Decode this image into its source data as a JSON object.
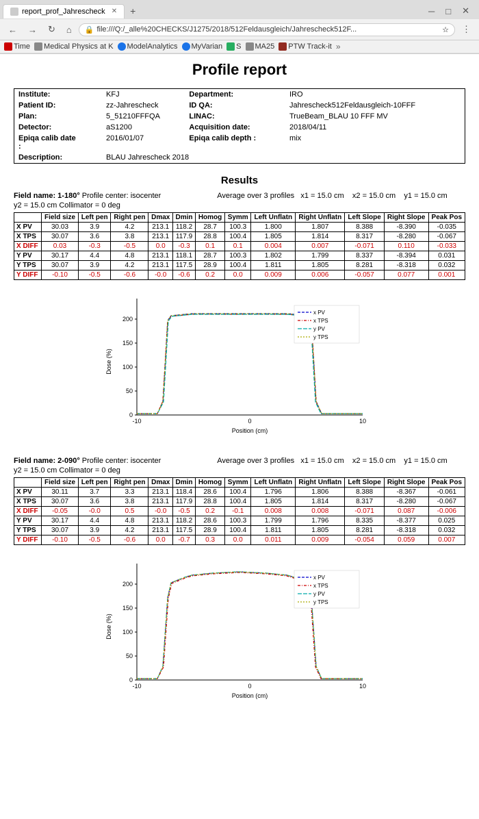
{
  "browser": {
    "tab_title": "report_prof_Jahrescheck",
    "address": "file:///Q:/_alle%20CHECKS/J1275/2018/512Feldausgleich/Jahrescheck512F...",
    "bookmarks": [
      "Time",
      "Medical Physics at K",
      "ModelAnalytics",
      "MyVarian",
      "S",
      "MA25",
      "PTW Track-it"
    ]
  },
  "page": {
    "title": "Profile report"
  },
  "info": {
    "institute_label": "Institute:",
    "institute_value": "KFJ",
    "department_label": "Department:",
    "department_value": "IRO",
    "patient_id_label": "Patient ID:",
    "patient_id_value": "zz-Jahrescheck",
    "id_qa_label": "ID QA:",
    "id_qa_value": "Jahrescheck512Feldausgleich-10FFF",
    "plan_label": "Plan:",
    "plan_value": "5_51210FFFQA",
    "linac_label": "LINAC:",
    "linac_value": "TrueBeam_BLAU  10 FFF MV",
    "detector_label": "Detector:",
    "detector_value": "aS1200",
    "acquisition_date_label": "Acquisition date:",
    "acquisition_date_value": "2018/04/11",
    "epiqa_calib_date_label": "Epiqa calib date\n:",
    "epiqa_calib_date_value": "2016/01/07",
    "epiqa_calib_depth_label": "Epiqa calib depth :",
    "epiqa_calib_depth_value": "mix",
    "description_label": "Description:",
    "description_value": "BLAU Jahrescheck 2018"
  },
  "results_title": "Results",
  "field1": {
    "name_label": "Field name: 1-180°",
    "profile_center": "Profile center:  isocenter",
    "average_label": "Average over 3 profiles",
    "x1": "x1 = 15.0 cm",
    "x2": "x2 = 15.0 cm",
    "y1": "y1 = 15.0 cm",
    "y2_line": "y2 =  15.0 cm   Collimator = 0 deg",
    "columns": [
      "Field size",
      "Left pen",
      "Right pen",
      "Dmax",
      "Dmin",
      "Homog",
      "Symm",
      "Left Unflatn",
      "Right Unflatn",
      "Left Slope",
      "Right Slope",
      "Peak Pos"
    ],
    "rows": [
      {
        "name": "X PV",
        "values": [
          "30.03",
          "3.9",
          "4.2",
          "213.1",
          "118.2",
          "28.7",
          "100.3",
          "1.800",
          "1.807",
          "8.388",
          "-8.390",
          "-0.035"
        ],
        "type": "pv"
      },
      {
        "name": "X TPS",
        "values": [
          "30.07",
          "3.6",
          "3.8",
          "213.1",
          "117.9",
          "28.8",
          "100.4",
          "1.805",
          "1.814",
          "8.317",
          "-8.280",
          "-0.067"
        ],
        "type": "normal"
      },
      {
        "name": "X DIFF",
        "values": [
          "0.03",
          "-0.3",
          "-0.5",
          "0.0",
          "-0.3",
          "0.1",
          "0.1",
          "0.004",
          "0.007",
          "-0.071",
          "0.110",
          "-0.033"
        ],
        "type": "diff"
      },
      {
        "name": "Y PV",
        "values": [
          "30.17",
          "4.4",
          "4.8",
          "213.1",
          "118.1",
          "28.7",
          "100.3",
          "1.802",
          "1.799",
          "8.337",
          "-8.394",
          "0.031"
        ],
        "type": "pv"
      },
      {
        "name": "Y TPS",
        "values": [
          "30.07",
          "3.9",
          "4.2",
          "213.1",
          "117.5",
          "28.9",
          "100.4",
          "1.811",
          "1.805",
          "8.281",
          "-8.318",
          "0.032"
        ],
        "type": "normal"
      },
      {
        "name": "Y DIFF",
        "values": [
          "-0.10",
          "-0.5",
          "-0.6",
          "-0.0",
          "-0.6",
          "0.2",
          "0.0",
          "0.009",
          "0.006",
          "-0.057",
          "0.077",
          "0.001"
        ],
        "type": "diff"
      }
    ]
  },
  "field2": {
    "name_label": "Field name: 2-090°",
    "profile_center": "Profile center:  isocenter",
    "average_label": "Average over 3 profiles",
    "x1": "x1 = 15.0 cm",
    "x2": "x2 = 15.0 cm",
    "y1": "y1 = 15.0 cm",
    "y2_line": "y2 =  15.0 cm   Collimator = 0 deg",
    "columns": [
      "Field size",
      "Left pen",
      "Right pen",
      "Dmax",
      "Dmin",
      "Homog",
      "Symm",
      "Left Unflatn",
      "Right Unflatn",
      "Left Slope",
      "Right Slope",
      "Peak Pos"
    ],
    "rows": [
      {
        "name": "X PV",
        "values": [
          "30.11",
          "3.7",
          "3.3",
          "213.1",
          "118.4",
          "28.6",
          "100.4",
          "1.796",
          "1.806",
          "8.388",
          "-8.367",
          "-0.061"
        ],
        "type": "pv"
      },
      {
        "name": "X TPS",
        "values": [
          "30.07",
          "3.6",
          "3.8",
          "213.1",
          "117.9",
          "28.8",
          "100.4",
          "1.805",
          "1.814",
          "8.317",
          "-8.280",
          "-0.067"
        ],
        "type": "normal"
      },
      {
        "name": "X DIFF",
        "values": [
          "-0.05",
          "-0.0",
          "0.5",
          "-0.0",
          "-0.5",
          "0.2",
          "-0.1",
          "0.008",
          "0.008",
          "-0.071",
          "0.087",
          "-0.006"
        ],
        "type": "diff"
      },
      {
        "name": "Y PV",
        "values": [
          "30.17",
          "4.4",
          "4.8",
          "213.1",
          "118.2",
          "28.6",
          "100.3",
          "1.799",
          "1.796",
          "8.335",
          "-8.377",
          "0.025"
        ],
        "type": "pv"
      },
      {
        "name": "Y TPS",
        "values": [
          "30.07",
          "3.9",
          "4.2",
          "213.1",
          "117.5",
          "28.9",
          "100.4",
          "1.811",
          "1.805",
          "8.281",
          "-8.318",
          "0.032"
        ],
        "type": "normal"
      },
      {
        "name": "Y DIFF",
        "values": [
          "-0.10",
          "-0.5",
          "-0.6",
          "0.0",
          "-0.7",
          "0.3",
          "0.0",
          "0.011",
          "0.009",
          "-0.054",
          "0.059",
          "0.007"
        ],
        "type": "diff"
      }
    ]
  },
  "legend": {
    "items": [
      "x PV",
      "x TPS",
      "y PV",
      "y TPS"
    ]
  }
}
